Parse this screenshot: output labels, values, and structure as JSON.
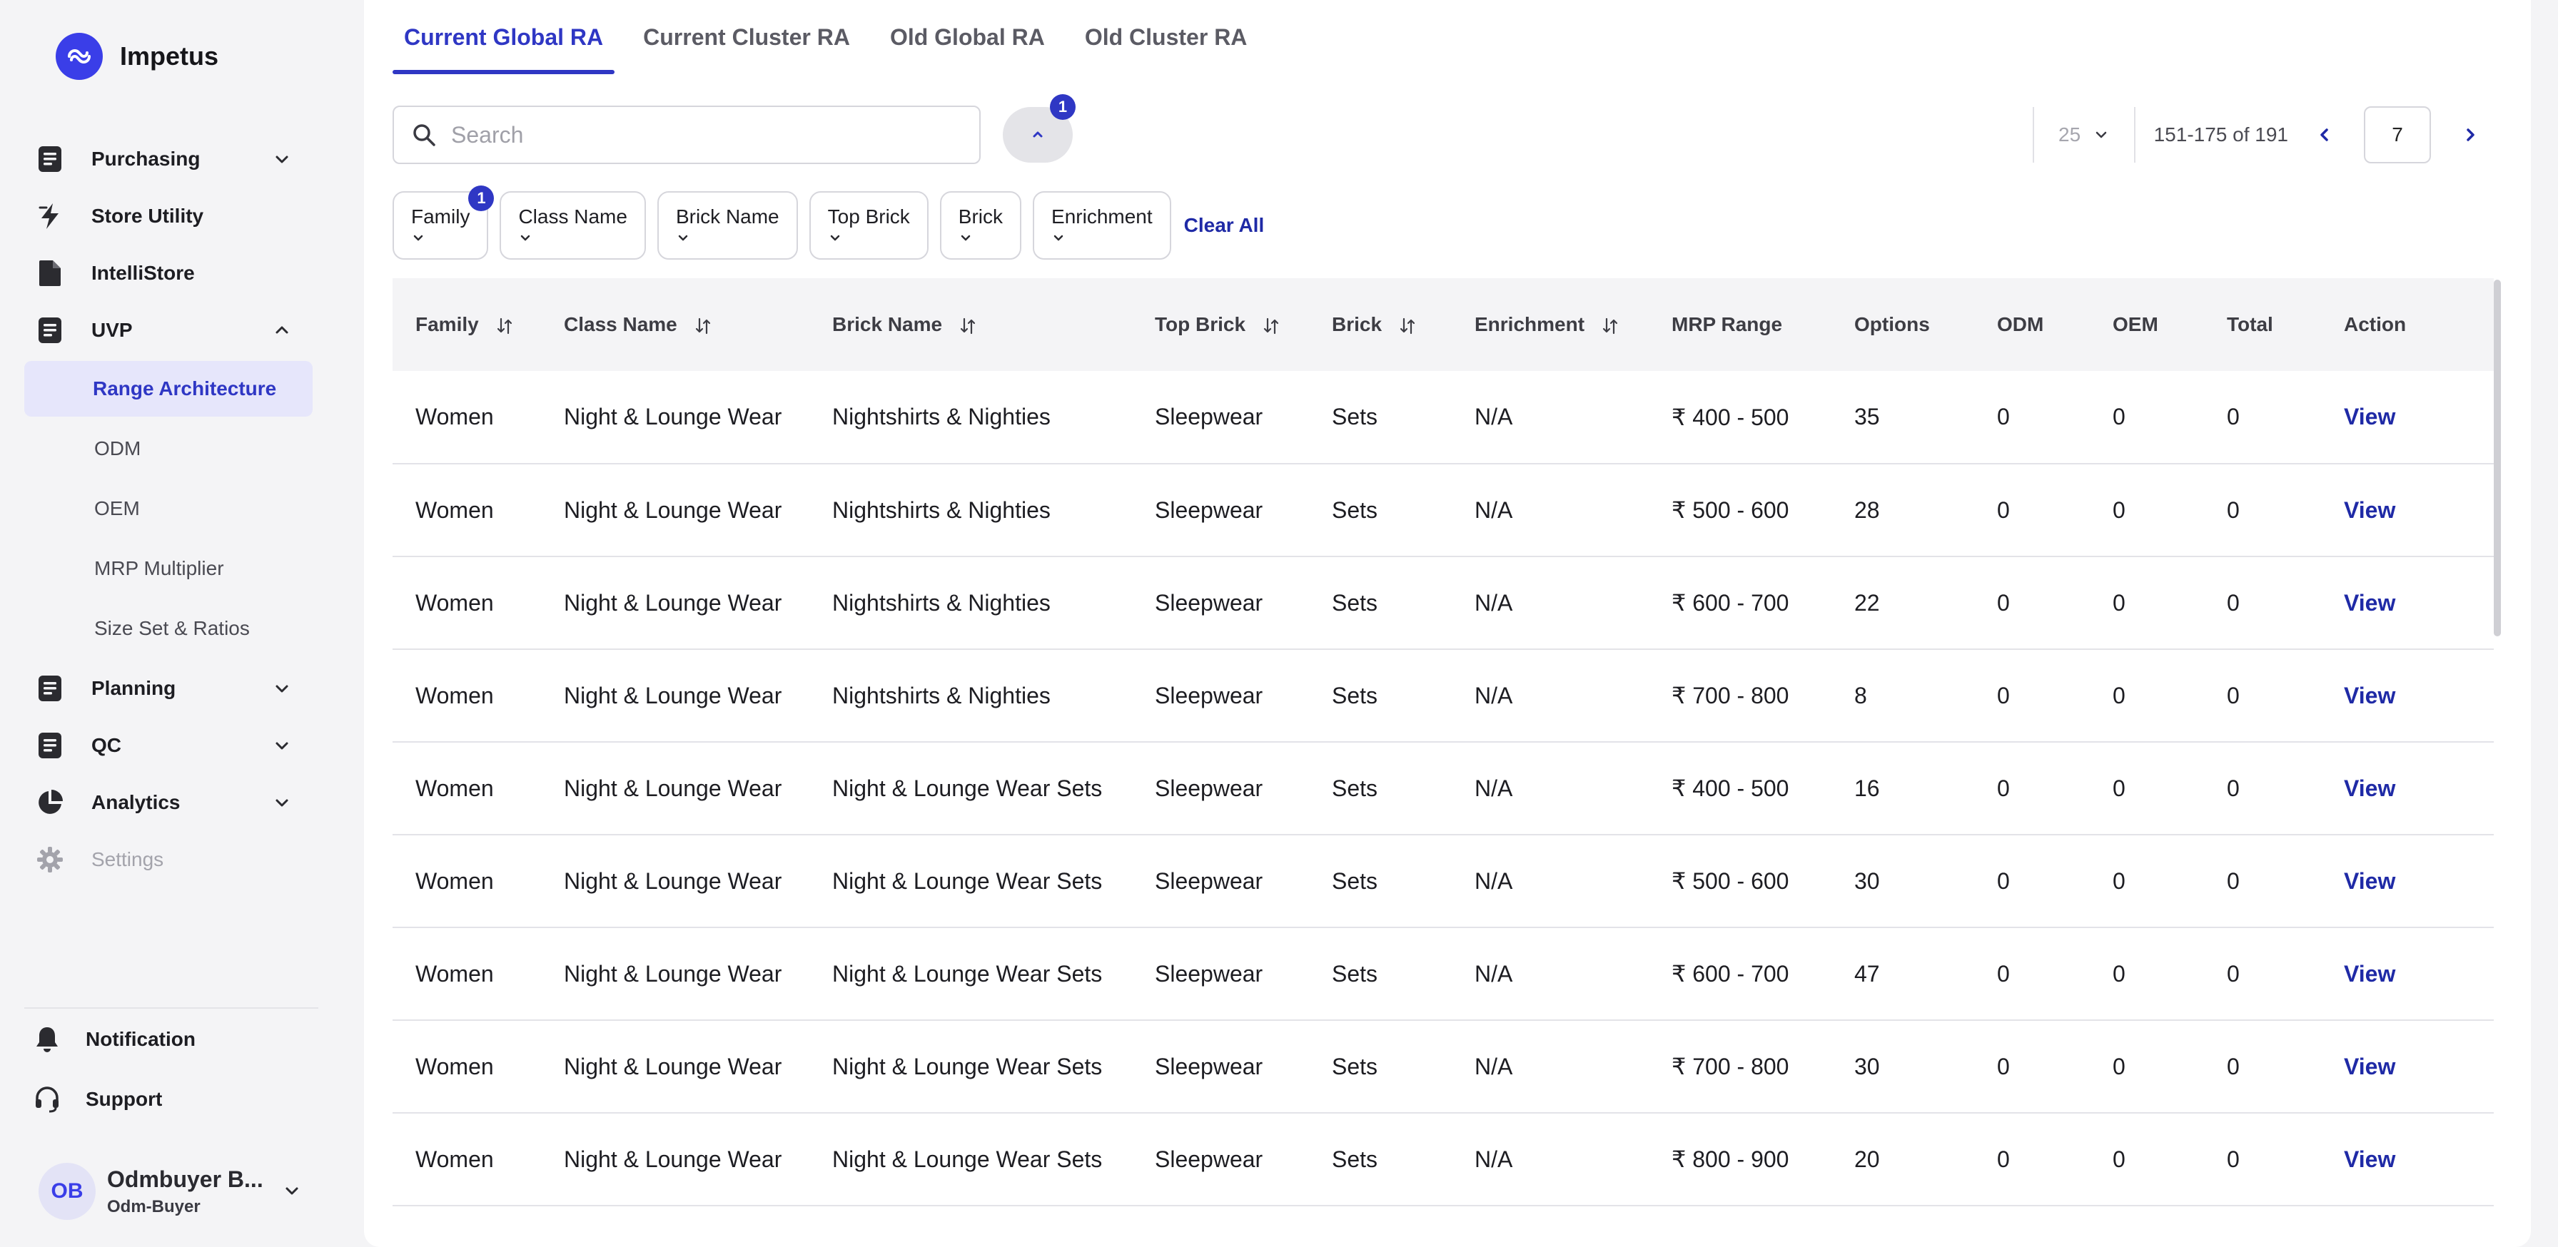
{
  "brand": {
    "name": "Impetus"
  },
  "sidebar": {
    "items": [
      {
        "label": "Purchasing",
        "icon": "document-icon",
        "expandable": true
      },
      {
        "label": "Store Utility",
        "icon": "lightning-icon",
        "expandable": false
      },
      {
        "label": "IntelliStore",
        "icon": "file-icon",
        "expandable": false
      },
      {
        "label": "UVP",
        "icon": "document-icon",
        "expandable": true,
        "expanded": true
      }
    ],
    "uvp_sub": [
      {
        "label": "Range Architecture",
        "active": true
      },
      {
        "label": "ODM"
      },
      {
        "label": "OEM"
      },
      {
        "label": "MRP Multiplier"
      },
      {
        "label": "Size Set & Ratios"
      }
    ],
    "items_after": [
      {
        "label": "Planning",
        "icon": "document-icon"
      },
      {
        "label": "QC",
        "icon": "document-icon"
      },
      {
        "label": "Analytics",
        "icon": "pie-chart-icon"
      },
      {
        "label": "Settings",
        "icon": "gear-icon",
        "disabled": true
      }
    ],
    "bottom": [
      {
        "label": "Notification",
        "icon": "bell-icon"
      },
      {
        "label": "Support",
        "icon": "headset-icon"
      }
    ],
    "user": {
      "initials": "OB",
      "name": "Odmbuyer B...",
      "role": "Odm-Buyer"
    }
  },
  "tabs": [
    "Current Global RA",
    "Current Cluster RA",
    "Old Global RA",
    "Old Cluster RA"
  ],
  "active_tab": 0,
  "search": {
    "placeholder": "Search",
    "value": ""
  },
  "filter_toggle": {
    "badge": "1"
  },
  "pagination": {
    "page_size": "25",
    "range": "151-175 of 191",
    "page": "7"
  },
  "filters": [
    {
      "label": "Family",
      "badge": "1"
    },
    {
      "label": "Class Name"
    },
    {
      "label": "Brick Name"
    },
    {
      "label": "Top Brick"
    },
    {
      "label": "Brick"
    },
    {
      "label": "Enrichment"
    }
  ],
  "clear_all_label": "Clear All",
  "table": {
    "columns": [
      {
        "label": "Family",
        "sortable": true
      },
      {
        "label": "Class Name",
        "sortable": true
      },
      {
        "label": "Brick Name",
        "sortable": true
      },
      {
        "label": "Top Brick",
        "sortable": true
      },
      {
        "label": "Brick",
        "sortable": true
      },
      {
        "label": "Enrichment",
        "sortable": true
      },
      {
        "label": "MRP Range",
        "sortable": false
      },
      {
        "label": "Options",
        "sortable": false
      },
      {
        "label": "ODM",
        "sortable": false
      },
      {
        "label": "OEM",
        "sortable": false
      },
      {
        "label": "Total",
        "sortable": false
      },
      {
        "label": "Action",
        "sortable": false
      }
    ],
    "rows": [
      [
        "Women",
        "Night & Lounge Wear",
        "Nightshirts & Nighties",
        "Sleepwear",
        "Sets",
        "N/A",
        "₹ 400 - 500",
        "35",
        "0",
        "0",
        "0",
        "View"
      ],
      [
        "Women",
        "Night & Lounge Wear",
        "Nightshirts & Nighties",
        "Sleepwear",
        "Sets",
        "N/A",
        "₹ 500 - 600",
        "28",
        "0",
        "0",
        "0",
        "View"
      ],
      [
        "Women",
        "Night & Lounge Wear",
        "Nightshirts & Nighties",
        "Sleepwear",
        "Sets",
        "N/A",
        "₹ 600 - 700",
        "22",
        "0",
        "0",
        "0",
        "View"
      ],
      [
        "Women",
        "Night & Lounge Wear",
        "Nightshirts & Nighties",
        "Sleepwear",
        "Sets",
        "N/A",
        "₹ 700 - 800",
        "8",
        "0",
        "0",
        "0",
        "View"
      ],
      [
        "Women",
        "Night & Lounge Wear",
        "Night & Lounge Wear Sets",
        "Sleepwear",
        "Sets",
        "N/A",
        "₹ 400 - 500",
        "16",
        "0",
        "0",
        "0",
        "View"
      ],
      [
        "Women",
        "Night & Lounge Wear",
        "Night & Lounge Wear Sets",
        "Sleepwear",
        "Sets",
        "N/A",
        "₹ 500 - 600",
        "30",
        "0",
        "0",
        "0",
        "View"
      ],
      [
        "Women",
        "Night & Lounge Wear",
        "Night & Lounge Wear Sets",
        "Sleepwear",
        "Sets",
        "N/A",
        "₹ 600 - 700",
        "47",
        "0",
        "0",
        "0",
        "View"
      ],
      [
        "Women",
        "Night & Lounge Wear",
        "Night & Lounge Wear Sets",
        "Sleepwear",
        "Sets",
        "N/A",
        "₹ 700 - 800",
        "30",
        "0",
        "0",
        "0",
        "View"
      ],
      [
        "Women",
        "Night & Lounge Wear",
        "Night & Lounge Wear Sets",
        "Sleepwear",
        "Sets",
        "N/A",
        "₹ 800 - 900",
        "20",
        "0",
        "0",
        "0",
        "View"
      ]
    ]
  },
  "colors": {
    "accent": "#2f37c4",
    "link": "#1f2aa6",
    "active_bg": "#e6e6fb"
  }
}
